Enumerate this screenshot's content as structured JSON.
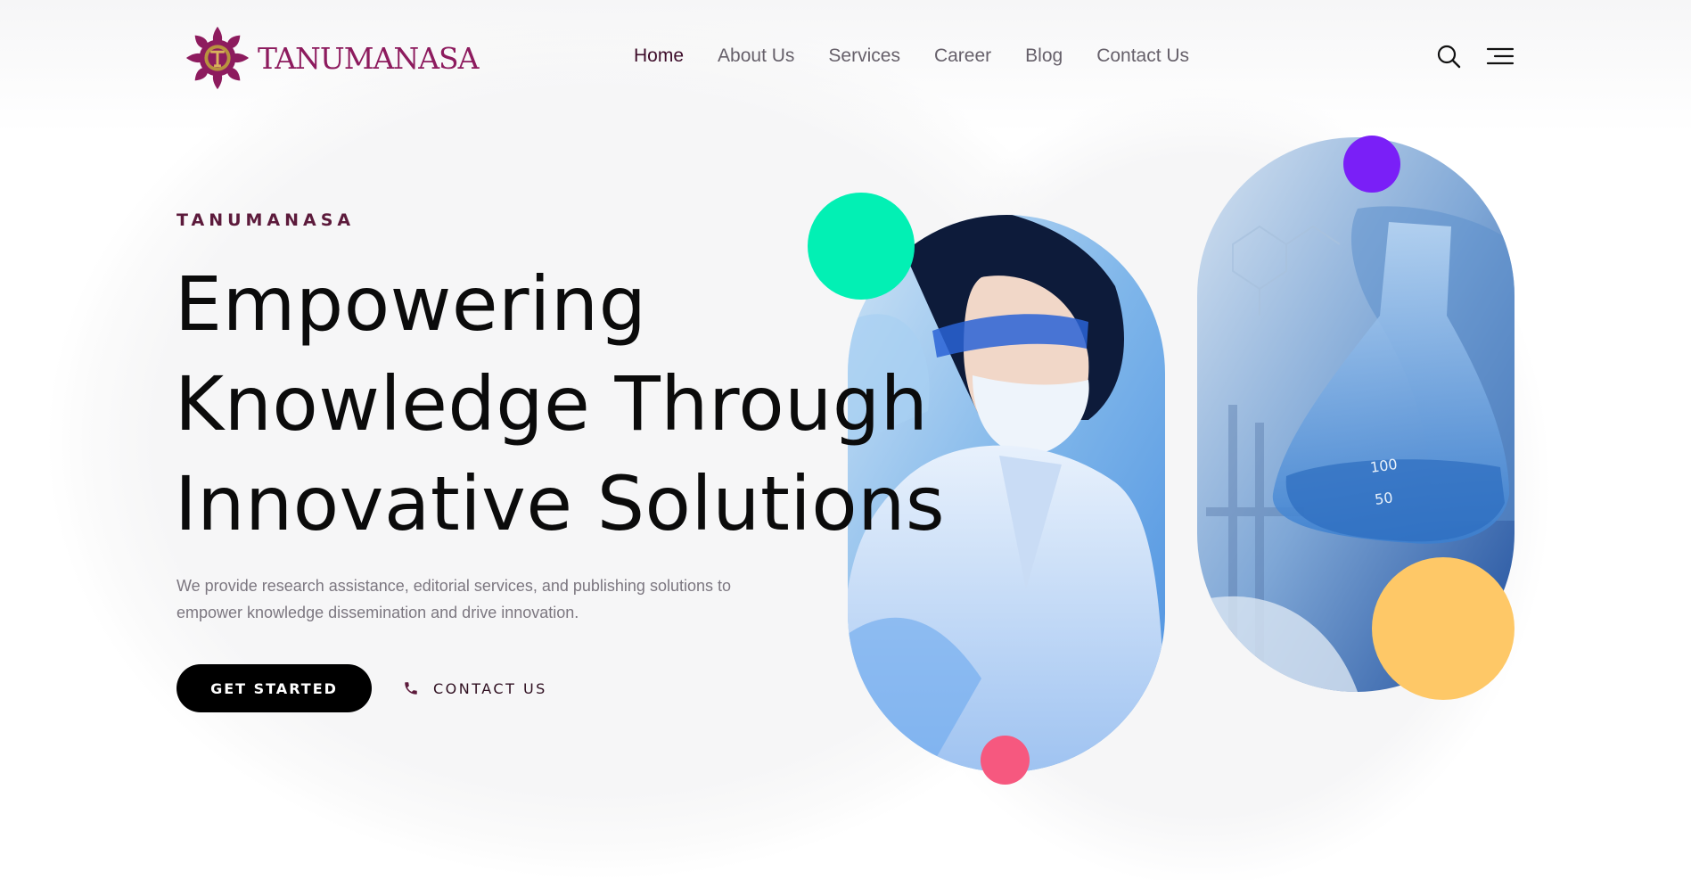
{
  "brand": {
    "name": "TANUMANASA",
    "logo_icon": "lotus-t-logo-icon",
    "colors": {
      "primary": "#8d1b5e",
      "dark": "#3d0c2a"
    }
  },
  "nav": {
    "items": [
      {
        "label": "Home",
        "active": true
      },
      {
        "label": "About Us",
        "active": false
      },
      {
        "label": "Services",
        "active": false
      },
      {
        "label": "Career",
        "active": false
      },
      {
        "label": "Blog",
        "active": false
      },
      {
        "label": "Contact Us",
        "active": false
      }
    ],
    "icons": [
      "search-icon",
      "menu-icon"
    ]
  },
  "hero": {
    "eyebrow": "TANUMANASA",
    "title_lines": [
      "Empowering",
      "Knowledge Through",
      "Innovative Solutions"
    ],
    "description": "We provide research assistance, editorial services, and publishing solutions to empower knowledge dissemination and drive innovation.",
    "primary_button": "GET STARTED",
    "secondary_button": "CONTACT US",
    "secondary_icon": "phone-icon"
  },
  "decor": {
    "colors": {
      "green": "#02f0b4",
      "purple": "#7a1ff7",
      "yellow": "#fec867",
      "pink": "#f6587f"
    },
    "images": [
      "scientist-in-lab-image",
      "laboratory-flask-image"
    ]
  }
}
